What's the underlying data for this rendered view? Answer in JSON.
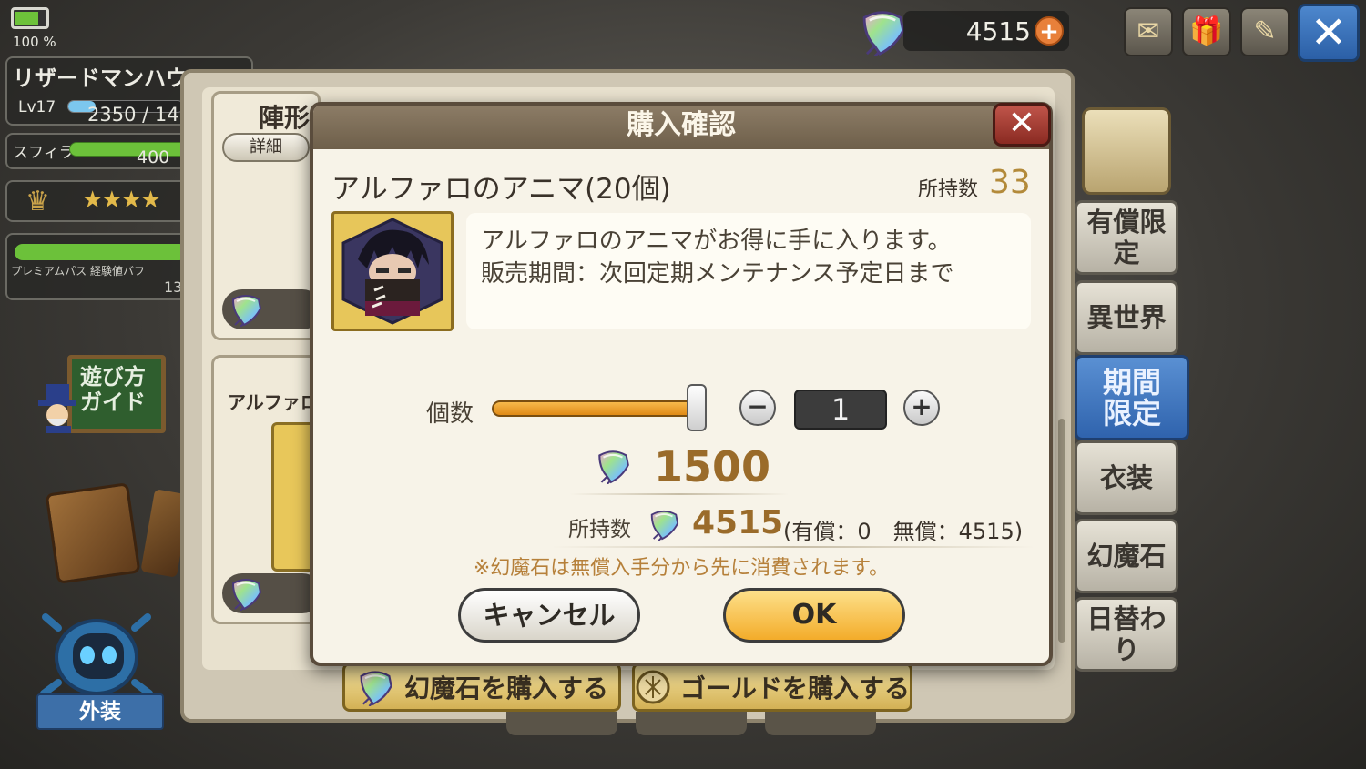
{
  "status": {
    "battery_percent_label": "100 %",
    "battery_level": 1.0
  },
  "player": {
    "name": "リザードマンハウス",
    "level_label": "Lv17",
    "exp_text": "2350 / 14",
    "stamina_label": "スフィラ",
    "stamina_value": "400",
    "rank_stars": "★★★★",
    "pass_label": "プレミアムパス 経験値バフ",
    "pass_value": "13"
  },
  "left_menu": {
    "guide_label": "遊び方 ガイド",
    "skin_label": "外装"
  },
  "currency": {
    "gems": "4515",
    "add_icon": "plus-icon"
  },
  "top_buttons": [
    {
      "name": "mail",
      "icon": "envelope-icon",
      "glyph": "✉"
    },
    {
      "name": "gift",
      "icon": "gift-box-icon",
      "glyph": "🎁"
    },
    {
      "name": "notes",
      "icon": "quill-scroll-icon",
      "glyph": "✎"
    }
  ],
  "close_glyph": "✕",
  "side_tabs": [
    {
      "label": "有償限定",
      "active": false
    },
    {
      "label": "異世界",
      "active": false
    },
    {
      "label": "期間\n限定",
      "active": true
    },
    {
      "label": "衣装",
      "active": false
    },
    {
      "label": "幻魔石",
      "active": false
    },
    {
      "label": "日替わり",
      "active": false
    }
  ],
  "shop": {
    "card1_title": "陣形",
    "card1_detail": "詳細",
    "card2_title": "アルファロ",
    "buy_gems_label": "幻魔石を購入する",
    "buy_gold_label": "ゴールドを購入する"
  },
  "dialog": {
    "title": "購入確認",
    "close_glyph": "✕",
    "item_name": "アルファロのアニマ(20個)",
    "owned_label": "所持数",
    "owned_count": "33",
    "description_line1": "アルファロのアニマがお得に手に入ります。",
    "description_line2": "販売期間：次回定期メンテナンス予定日まで",
    "quantity_label": "個数",
    "quantity_value": "1",
    "slider_fraction": 1.0,
    "minus_glyph": "−",
    "plus_glyph": "+",
    "price": "1500",
    "owned_gems_label": "所持数",
    "owned_gems": "4515",
    "owned_gems_detail": "(有償：0　無償：4515)",
    "note": "※幻魔石は無償入手分から先に消費されます。",
    "cancel_label": "キャンセル",
    "ok_label": "OK"
  }
}
